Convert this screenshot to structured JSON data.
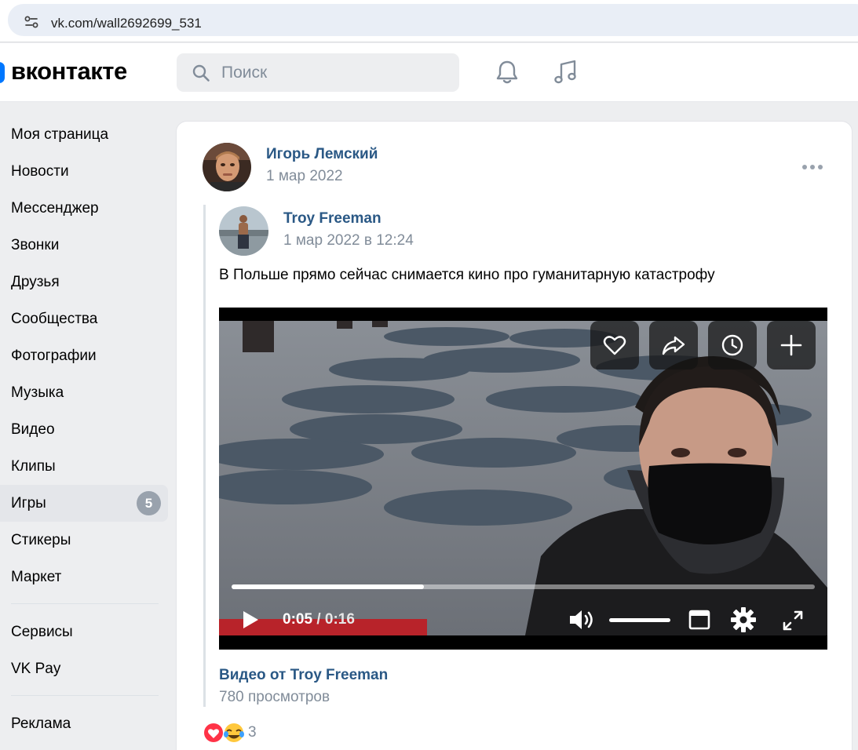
{
  "browser": {
    "url": "vk.com/wall2692699_531"
  },
  "header": {
    "logo": "вконтакте",
    "search_placeholder": "Поиск",
    "accent_color": "#0077ff"
  },
  "sidebar": {
    "items": [
      {
        "label": "Моя страница"
      },
      {
        "label": "Новости"
      },
      {
        "label": "Мессенджер"
      },
      {
        "label": "Звонки"
      },
      {
        "label": "Друзья"
      },
      {
        "label": "Сообщества"
      },
      {
        "label": "Фотографии"
      },
      {
        "label": "Музыка"
      },
      {
        "label": "Видео"
      },
      {
        "label": "Клипы"
      },
      {
        "label": "Игры",
        "badge": "5"
      },
      {
        "label": "Стикеры"
      },
      {
        "label": "Маркет"
      }
    ],
    "secondary": [
      {
        "label": "Сервисы"
      },
      {
        "label": "VK Pay"
      }
    ],
    "tertiary": [
      {
        "label": "Реклама"
      }
    ]
  },
  "post": {
    "author": "Игорь Лемский",
    "date": "1 мар 2022",
    "repost": {
      "author": "Troy Freeman",
      "date": "1 мар 2022 в 12:24",
      "text": "В Польше прямо сейчас снимается кино про гуманитарную катастрофу"
    },
    "video": {
      "current_time": "0:05",
      "separator": "/",
      "total_time": "0:16",
      "progress": 0.33,
      "volume": 1.0,
      "title": "Видео от Troy Freeman",
      "views": "780 просмотров",
      "actions": [
        "heart-icon",
        "share-icon",
        "clock-icon",
        "plus-icon"
      ]
    },
    "reactions": {
      "count": "3"
    }
  }
}
